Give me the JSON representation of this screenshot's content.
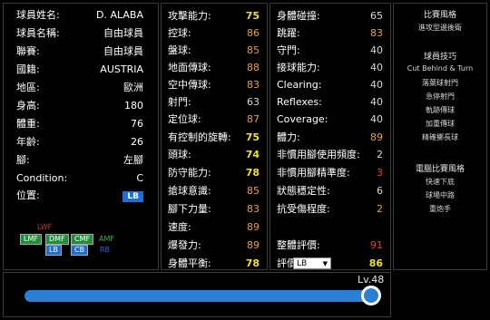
{
  "player": {
    "rows": [
      {
        "label": "球員姓名:",
        "value": "D. ALABA"
      },
      {
        "label": "球員名稱:",
        "value": "自由球員"
      },
      {
        "label": "聯賽:",
        "value": "自由球員"
      },
      {
        "label": "國籍:",
        "value": "AUSTRIA"
      },
      {
        "label": "地區:",
        "value": "歐洲"
      },
      {
        "label": "身高:",
        "value": "180"
      },
      {
        "label": "體重:",
        "value": "76"
      },
      {
        "label": "年齡:",
        "value": "26"
      },
      {
        "label": "腳:",
        "value": "左腳"
      },
      {
        "label": "Condition:",
        "value": "C"
      }
    ],
    "position_label": "位置:",
    "position_value": "LB"
  },
  "positions": {
    "lwf": "LWF",
    "lmf": "LMF",
    "dmf": "DMF",
    "cmf": "CMF",
    "amf": "AMF",
    "lb": "LB",
    "cb": "CB",
    "rb": "RB"
  },
  "stats_left": [
    {
      "label": "攻擊能力:",
      "value": "75"
    },
    {
      "label": "控球:",
      "value": "86"
    },
    {
      "label": "盤球:",
      "value": "85"
    },
    {
      "label": "地面傳球:",
      "value": "88"
    },
    {
      "label": "空中傳球:",
      "value": "83"
    },
    {
      "label": "射門:",
      "value": "63"
    },
    {
      "label": "定位球:",
      "value": "87"
    },
    {
      "label": "有控制的旋轉:",
      "value": "75"
    },
    {
      "label": "頭球:",
      "value": "74"
    },
    {
      "label": "防守能力:",
      "value": "78"
    },
    {
      "label": "搶球意識:",
      "value": "85"
    },
    {
      "label": "腳下力量:",
      "value": "83"
    },
    {
      "label": "速度:",
      "value": "89"
    },
    {
      "label": "爆發力:",
      "value": "89"
    },
    {
      "label": "身體平衡:",
      "value": "78"
    }
  ],
  "stats_right": [
    {
      "label": "身體碰撞:",
      "value": "65"
    },
    {
      "label": "跳躍:",
      "value": "83"
    },
    {
      "label": "守門:",
      "value": "40"
    },
    {
      "label": "接球能力:",
      "value": "40"
    },
    {
      "label": "Clearing:",
      "value": "40"
    },
    {
      "label": "Reflexes:",
      "value": "40"
    },
    {
      "label": "Coverage:",
      "value": "40"
    },
    {
      "label": "體力:",
      "value": "89"
    },
    {
      "label": "非慣用腳使用頻度:",
      "value": "2"
    },
    {
      "label": "非慣用腳精準度:",
      "value": "3"
    },
    {
      "label": "狀態穩定性:",
      "value": "6"
    },
    {
      "label": "抗受傷程度:",
      "value": "2"
    }
  ],
  "overall": {
    "label": "整體評價:",
    "value": "91"
  },
  "rating": {
    "label": "評價",
    "select_value": "LB",
    "value": "86"
  },
  "skills": {
    "heading1": "比賽風格",
    "style": "進攻型邊後衛",
    "heading2": "球員技巧",
    "items": [
      "Cut Behind & Turn",
      "落葉球射門",
      "急停射門",
      "軌跡傳球",
      "加重傳球",
      "精確擲長球"
    ],
    "heading3": "電腦比賽風格",
    "ai_items": [
      "快速下底",
      "球場中路",
      "重炮手"
    ]
  },
  "level": {
    "label": "Lv.48",
    "fraction": 0.97
  },
  "colors": {
    "panel_border": "#3a3a3a",
    "accent": "#2b7fd4",
    "high": "#f2e21a",
    "mid": "#f0a02a",
    "low": "#f03a28"
  }
}
